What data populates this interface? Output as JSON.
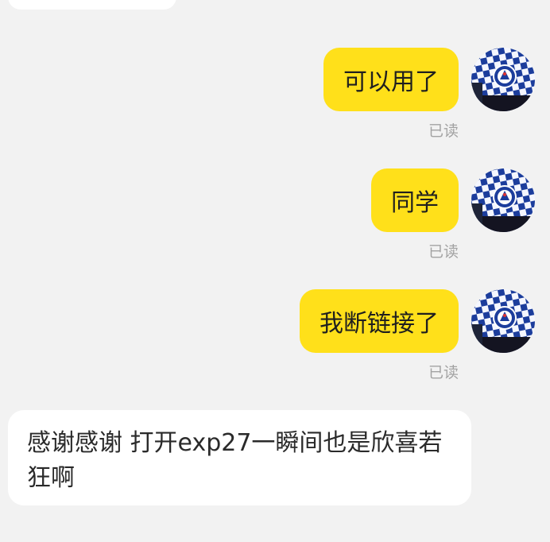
{
  "messages": [
    {
      "text": "可以用了",
      "status": "已读"
    },
    {
      "text": "同学",
      "status": "已读"
    },
    {
      "text": "我断链接了",
      "status": "已读"
    }
  ],
  "incoming": {
    "text": "感谢感谢 打开exp27一瞬间也是欣喜若狂啊"
  },
  "avatar": {
    "icon": "chelsea-crest-flag-icon",
    "colors": {
      "blue": "#1c3d9c",
      "white": "#ffffff",
      "dark": "#141421"
    }
  },
  "colors": {
    "outgoing_bubble": "#ffe01a",
    "incoming_bubble": "#ffffff",
    "background": "#f2f2f2",
    "status_text": "#a3a3a3"
  }
}
